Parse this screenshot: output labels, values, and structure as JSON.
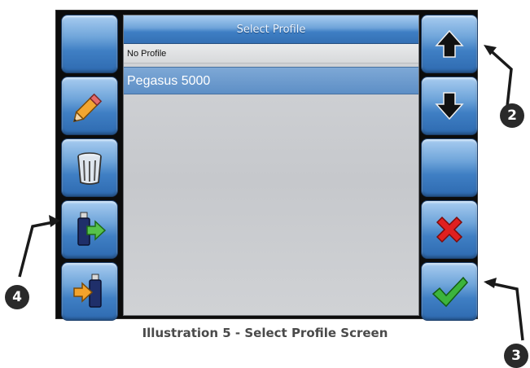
{
  "screen": {
    "title": "Select Profile",
    "list_items": [
      {
        "label": "No Profile",
        "selected": false
      },
      {
        "label": "Pegasus 5000",
        "selected": true
      }
    ]
  },
  "left_buttons": [
    {
      "name": "blank-left-button",
      "icon": "none"
    },
    {
      "name": "edit-button",
      "icon": "pencil-icon"
    },
    {
      "name": "delete-button",
      "icon": "trash-icon"
    },
    {
      "name": "export-usb-button",
      "icon": "usb-export-icon"
    },
    {
      "name": "import-usb-button",
      "icon": "usb-import-icon"
    }
  ],
  "right_buttons": [
    {
      "name": "scroll-up-button",
      "icon": "arrow-up-icon"
    },
    {
      "name": "scroll-down-button",
      "icon": "arrow-down-icon"
    },
    {
      "name": "blank-right-button",
      "icon": "none"
    },
    {
      "name": "cancel-button",
      "icon": "red-x-icon"
    },
    {
      "name": "accept-button",
      "icon": "green-check-icon"
    }
  ],
  "caption": "Illustration 5 - Select Profile  Screen",
  "callouts": {
    "c2": "2",
    "c3": "3",
    "c4": "4"
  },
  "colors": {
    "button_blue": "#3f7fc4",
    "selected_row": "#5d8fc6",
    "cancel_red": "#e02020",
    "accept_green": "#3cb43c",
    "arrow_black": "#111111"
  }
}
